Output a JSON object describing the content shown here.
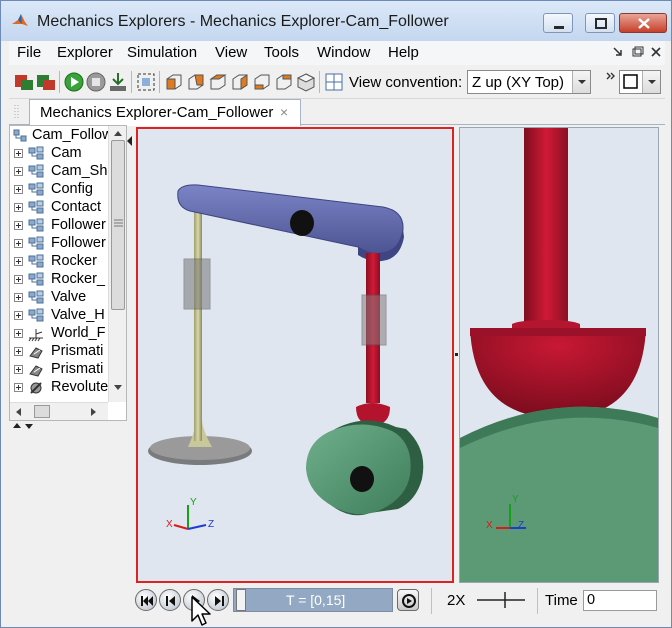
{
  "window": {
    "title": "Mechanics Explorers - Mechanics Explorer-Cam_Follower"
  },
  "menu": {
    "items": [
      "File",
      "Explorer",
      "Simulation",
      "View",
      "Tools",
      "Window",
      "Help"
    ]
  },
  "toolbar": {
    "view_convention_label": "View convention:",
    "view_convention_value": "Z up (XY Top)"
  },
  "tab": {
    "label": "Mechanics Explorer-Cam_Follower",
    "close_glyph": "×"
  },
  "tree": {
    "root": "Cam_Follower",
    "items": [
      {
        "label": "Cam",
        "icon": "subsystem-icon"
      },
      {
        "label": "Cam_Shaft",
        "icon": "subsystem-icon"
      },
      {
        "label": "Config",
        "icon": "subsystem-icon"
      },
      {
        "label": "Contact",
        "icon": "subsystem-icon"
      },
      {
        "label": "Follower",
        "icon": "subsystem-icon"
      },
      {
        "label": "Follower",
        "icon": "subsystem-icon"
      },
      {
        "label": "Rocker",
        "icon": "subsystem-icon"
      },
      {
        "label": "Rocker_",
        "icon": "subsystem-icon"
      },
      {
        "label": "Valve",
        "icon": "subsystem-icon"
      },
      {
        "label": "Valve_H",
        "icon": "subsystem-icon"
      },
      {
        "label": "World_F",
        "icon": "world-frame-icon"
      },
      {
        "label": "Prismati",
        "icon": "prismatic-joint-icon"
      },
      {
        "label": "Prismati",
        "icon": "prismatic-joint-icon"
      },
      {
        "label": "Revolute",
        "icon": "revolute-joint-icon"
      }
    ]
  },
  "axes_triad": {
    "x": "X",
    "y": "Y",
    "z": "Z"
  },
  "playback": {
    "time_range": "T = [0,15]",
    "speed": "2X",
    "time_label": "Time",
    "time_value": "0"
  },
  "colors": {
    "rocker": "#6770b0",
    "valve_stem": "#c8c79a",
    "follower": "#b4132e",
    "cam": "#5a9a76",
    "canvas_bg": "#dfe6ef",
    "active_view_border": "#dd2222"
  }
}
